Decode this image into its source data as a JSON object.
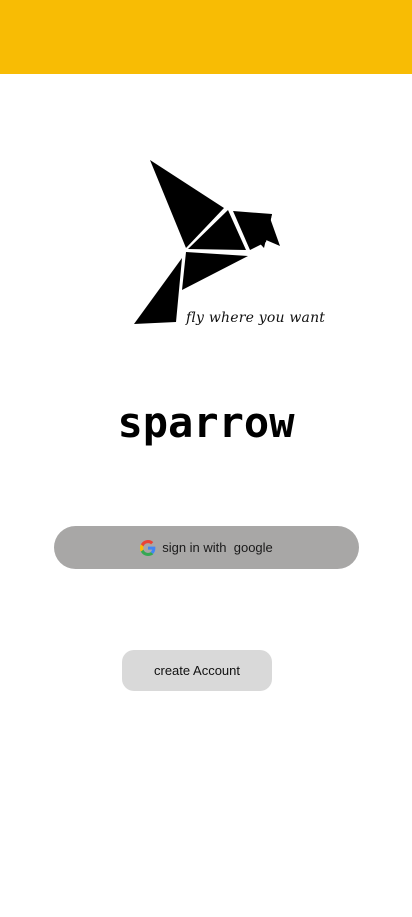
{
  "theme": {
    "topbar_color": "#F8BC04",
    "google_button_color": "#A8A7A6",
    "create_button_color": "#D9D9D9",
    "logo_color": "#000000"
  },
  "logo": {
    "icon": "origami-sparrow-icon",
    "tagline": "fly where you want"
  },
  "app_name": "sparrow",
  "google_signin": {
    "icon": "google-g-icon",
    "label": "sign in with  google"
  },
  "create_account": {
    "label": "create Account"
  }
}
